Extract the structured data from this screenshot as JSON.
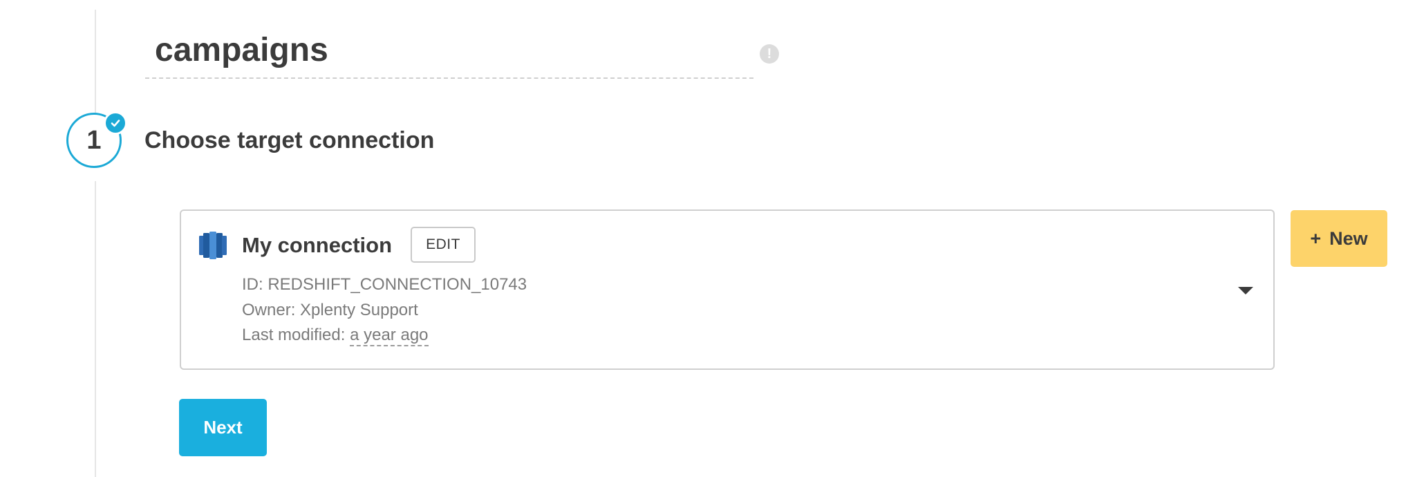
{
  "package_name": {
    "value": "campaigns"
  },
  "info_icon": {
    "glyph": "!",
    "icon": "info-icon"
  },
  "step": {
    "number": "1",
    "title": "Choose target connection",
    "completed": true,
    "accent_color": "#1ba9d6"
  },
  "connection": {
    "name": "My connection",
    "edit_label": "EDIT",
    "id_label": "ID: ",
    "id_value": "REDSHIFT_CONNECTION_10743",
    "owner_label": "Owner: ",
    "owner_value": "Xplenty Support",
    "modified_label": "Last modified: ",
    "modified_value": "a year ago",
    "icon": "redshift-database-icon"
  },
  "new_button": {
    "plus": "+",
    "label": "New",
    "color": "#fdd36a"
  },
  "next_button": {
    "label": "Next",
    "color": "#1aafde"
  }
}
